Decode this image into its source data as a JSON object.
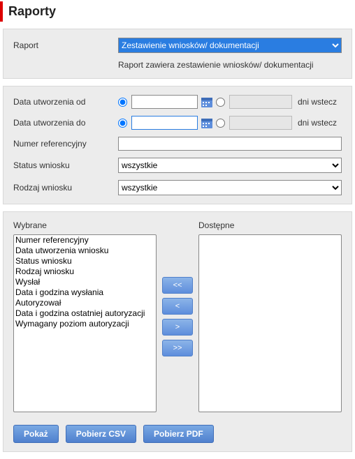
{
  "title": "Raporty",
  "reportPanel": {
    "label": "Raport",
    "selected": "Zestawienie wniosków/ dokumentacji",
    "description": "Raport zawiera zestawienie wniosków/ dokumentacji"
  },
  "filters": {
    "dateFrom": {
      "label": "Data utworzenia od",
      "value": "",
      "days": "",
      "suffix": "dni wstecz"
    },
    "dateTo": {
      "label": "Data utworzenia do",
      "value": "",
      "days": "",
      "suffix": "dni wstecz"
    },
    "refNo": {
      "label": "Numer referencyjny",
      "value": ""
    },
    "status": {
      "label": "Status wniosku",
      "selected": "wszystkie"
    },
    "type": {
      "label": "Rodzaj wniosku",
      "selected": "wszystkie"
    }
  },
  "dual": {
    "selectedLabel": "Wybrane",
    "availableLabel": "Dostępne",
    "selected": [
      "Numer referencyjny",
      "Data utworzenia wniosku",
      "Status wniosku",
      "Rodzaj wniosku",
      "Wysłał",
      "Data i godzina wysłania",
      "Autoryzował",
      "Data i godzina ostatniej autoryzacji",
      "Wymagany poziom autoryzacji"
    ],
    "available": [],
    "buttons": {
      "allLeft": "<<",
      "left": "<",
      "right": ">",
      "allRight": ">>"
    }
  },
  "actions": {
    "show": "Pokaż",
    "csv": "Pobierz CSV",
    "pdf": "Pobierz PDF"
  }
}
